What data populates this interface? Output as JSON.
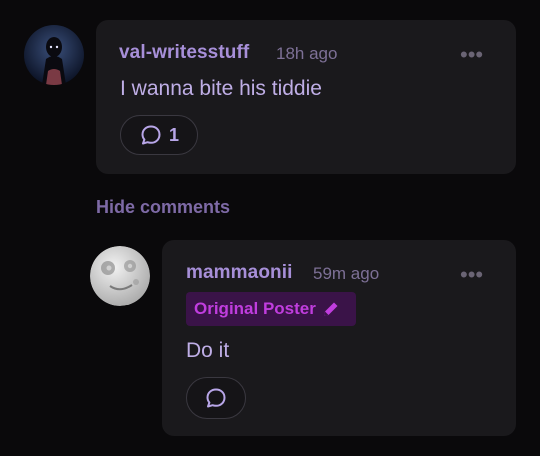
{
  "comment": {
    "author": "val-writesstuff",
    "time": "18h ago",
    "text": "I wanna bite his tiddie",
    "reply_count": "1",
    "menu_glyph": "•••",
    "avatar_icon": "user-avatar-dark-figure",
    "reply_icon": "speech-bubble-icon"
  },
  "hide_comments_label": "Hide comments",
  "reply": {
    "author": "mammaonii",
    "time": "59m ago",
    "badge_label": "Original Poster",
    "badge_icon": "pencil-icon",
    "text": "Do it",
    "menu_glyph": "•••",
    "avatar_icon": "user-avatar-moon",
    "reply_icon": "speech-bubble-icon"
  },
  "colors": {
    "background": "#0a090b",
    "card": "#1a191c",
    "accent": "#a78fd8",
    "badge_bg": "#3a1348",
    "badge_text": "#c03dde"
  }
}
